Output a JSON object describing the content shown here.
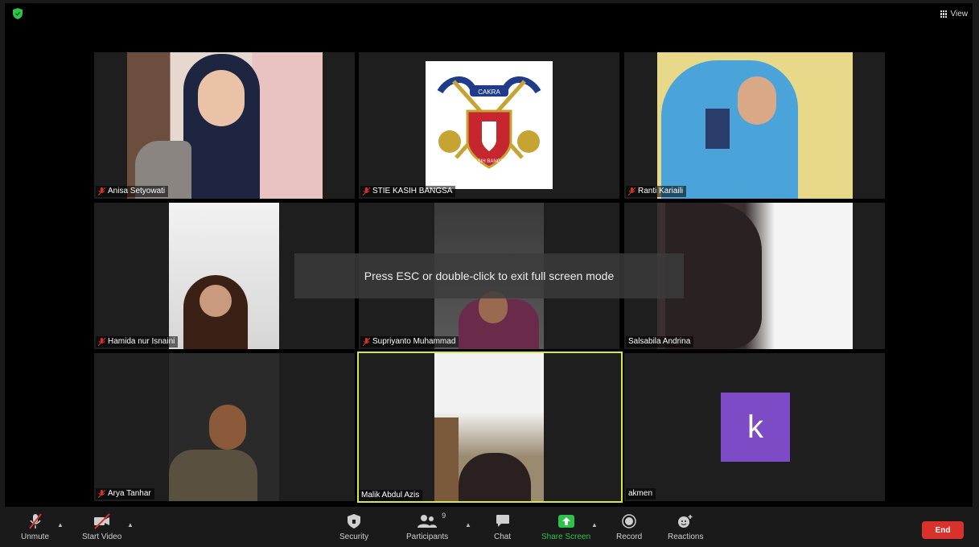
{
  "view_button": {
    "label": "View"
  },
  "participants": [
    {
      "name": "Anisa Setyowati"
    },
    {
      "name": "STIE KASIH BANGSA"
    },
    {
      "name": "Ranti Kariaili"
    },
    {
      "name": "Hamida nur Isnaini"
    },
    {
      "name": "Supriyanto Muhammad"
    },
    {
      "name": "Salsabila Andrina"
    },
    {
      "name": "Arya Tanhar"
    },
    {
      "name": "Malik Abdul Azis"
    },
    {
      "name": "akmen",
      "avatar_letter": "k",
      "avatar_color": "#7d4bc5"
    }
  ],
  "logo": {
    "ribbon_text": "CAKRA",
    "shield_text": "KASIH BANGSA"
  },
  "banner": {
    "text": "Press ESC or double-click to exit full screen mode"
  },
  "toolbar": {
    "unmute": "Unmute",
    "start_video": "Start Video",
    "security": "Security",
    "participants": "Participants",
    "participants_count": "9",
    "chat": "Chat",
    "share_screen": "Share Screen",
    "record": "Record",
    "reactions": "Reactions",
    "end": "End"
  },
  "colors": {
    "active_speaker": "#d6e64b",
    "share_green": "#2ec24a",
    "end_red": "#d9312b",
    "muted_red": "#d9312b"
  }
}
